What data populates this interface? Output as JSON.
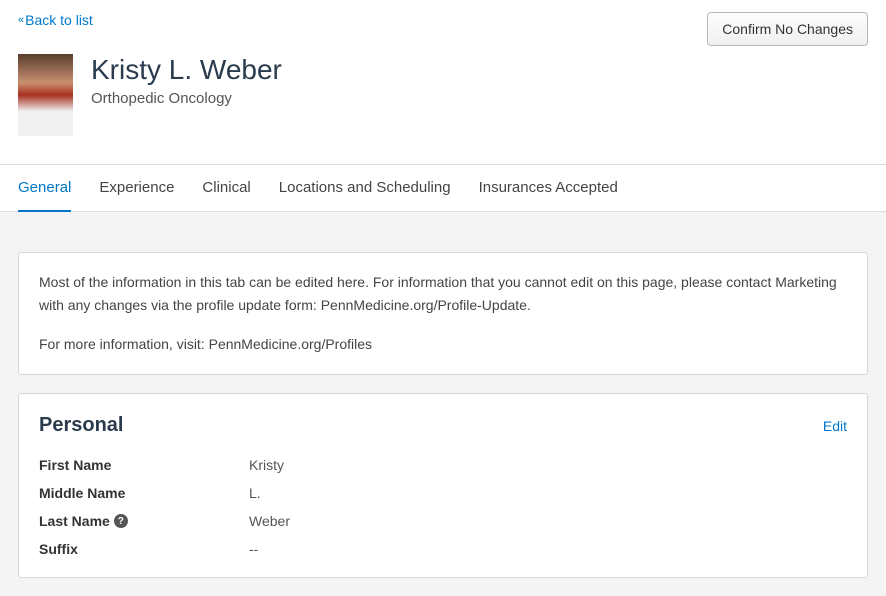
{
  "header": {
    "back_label": "Back to list",
    "confirm_label": "Confirm No Changes",
    "name": "Kristy L. Weber",
    "specialty": "Orthopedic Oncology"
  },
  "tabs": [
    {
      "label": "General",
      "active": true
    },
    {
      "label": "Experience",
      "active": false
    },
    {
      "label": "Clinical",
      "active": false
    },
    {
      "label": "Locations and Scheduling",
      "active": false
    },
    {
      "label": "Insurances Accepted",
      "active": false
    }
  ],
  "info_notice": {
    "line1": "Most of the information in this tab can be edited here. For information that you cannot edit on this page, please contact Marketing with any changes via the profile update form: PennMedicine.org/Profile-Update.",
    "line2": "For more information, visit: PennMedicine.org/Profiles"
  },
  "personal": {
    "title": "Personal",
    "edit_label": "Edit",
    "fields": [
      {
        "label": "First Name",
        "value": "Kristy",
        "help": false
      },
      {
        "label": "Middle Name",
        "value": "L.",
        "help": false
      },
      {
        "label": "Last Name",
        "value": "Weber",
        "help": true
      },
      {
        "label": "Suffix",
        "value": "--",
        "help": false
      }
    ]
  }
}
